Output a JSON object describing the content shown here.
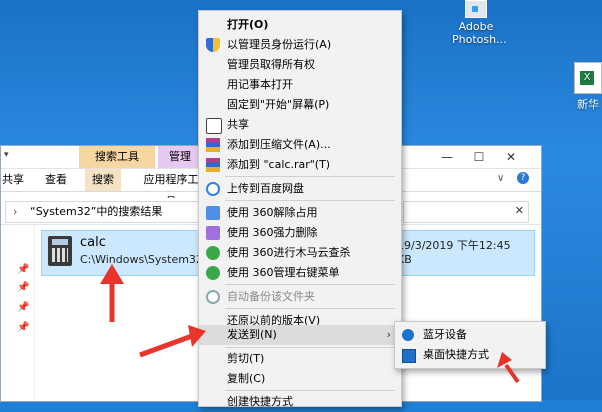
{
  "desktop": {
    "icons": [
      {
        "label_line1": "Adobe",
        "label_line2": "Photosh..."
      },
      {
        "label_line1": "新华"
      }
    ]
  },
  "explorer": {
    "context_tabs": {
      "search": "搜索工具",
      "manage": "管理"
    },
    "ribbon_tabs": [
      "共享",
      "查看",
      "搜索",
      "应用程序工具"
    ],
    "window_buttons": {
      "minimize": "—",
      "maximize": "☐",
      "close": "✕"
    },
    "address": "“System32”中的搜索结果",
    "result": {
      "name": "calc",
      "path": "C:\\Windows\\System32",
      "date": "19/3/2019 下午12:45",
      "size": "KB"
    }
  },
  "context_menu": {
    "items": [
      {
        "label": "打开(O)"
      },
      {
        "label": "以管理员身份运行(A)"
      },
      {
        "label": "管理员取得所有权"
      },
      {
        "label": "用记事本打开"
      },
      {
        "label": "固定到\"开始\"屏幕(P)"
      },
      {
        "label": "共享"
      },
      {
        "label": "添加到压缩文件(A)..."
      },
      {
        "label": "添加到 \"calc.rar\"(T)"
      },
      {
        "label": "上传到百度网盘"
      },
      {
        "label": "使用 360解除占用"
      },
      {
        "label": "使用 360强力删除"
      },
      {
        "label": "使用 360进行木马云查杀"
      },
      {
        "label": "使用 360管理右键菜单"
      },
      {
        "label": "自动备份该文件夹"
      },
      {
        "label": "还原以前的版本(V)"
      },
      {
        "label": "发送到(N)"
      },
      {
        "label": "剪切(T)"
      },
      {
        "label": "复制(C)"
      },
      {
        "label": "创建快捷方式"
      }
    ]
  },
  "send_to_submenu": {
    "items": [
      {
        "label": "蓝牙设备"
      },
      {
        "label": "桌面快捷方式"
      }
    ]
  },
  "colors": {
    "desktop": "#1e7fd6",
    "selection": "#cce8ff",
    "arrow": "#e8342a",
    "search_tools_tab": "#f6d7a3",
    "manage_tab": "#e5c9f0"
  }
}
